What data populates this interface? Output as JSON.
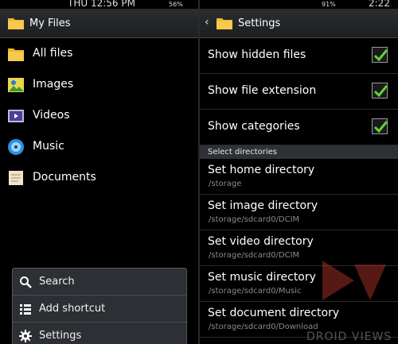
{
  "left_status": {
    "time": "THU 12:56 PM",
    "battery": "56%"
  },
  "right_status": {
    "battery": "91%",
    "time": "2:22"
  },
  "left_title": "My Files",
  "nav": [
    {
      "label": "All files",
      "icon": "folder-icon"
    },
    {
      "label": "Images",
      "icon": "images-icon"
    },
    {
      "label": "Videos",
      "icon": "videos-icon"
    },
    {
      "label": "Music",
      "icon": "music-icon"
    },
    {
      "label": "Documents",
      "icon": "documents-icon"
    }
  ],
  "menu": [
    {
      "label": "Search",
      "icon": "search-icon"
    },
    {
      "label": "Add shortcut",
      "icon": "add-shortcut-icon"
    },
    {
      "label": "Settings",
      "icon": "gear-icon"
    }
  ],
  "right_title": "Settings",
  "toggles": [
    {
      "label": "Show hidden files",
      "checked": true
    },
    {
      "label": "Show file extension",
      "checked": true
    },
    {
      "label": "Show categories",
      "checked": true
    }
  ],
  "section_header": "Select directories",
  "directories": [
    {
      "title": "Set home directory",
      "path": "/storage"
    },
    {
      "title": "Set image directory",
      "path": "/storage/sdcard0/DCIM"
    },
    {
      "title": "Set video directory",
      "path": "/storage/sdcard0/DCIM"
    },
    {
      "title": "Set music directory",
      "path": "/storage/sdcard0/Music"
    },
    {
      "title": "Set document directory",
      "path": "/storage/sdcard0/Download"
    }
  ],
  "watermark": "DROID VIEWS",
  "colors": {
    "check": "#5fd13a",
    "folder": "#f2b32a",
    "accent": "#c0392b"
  }
}
